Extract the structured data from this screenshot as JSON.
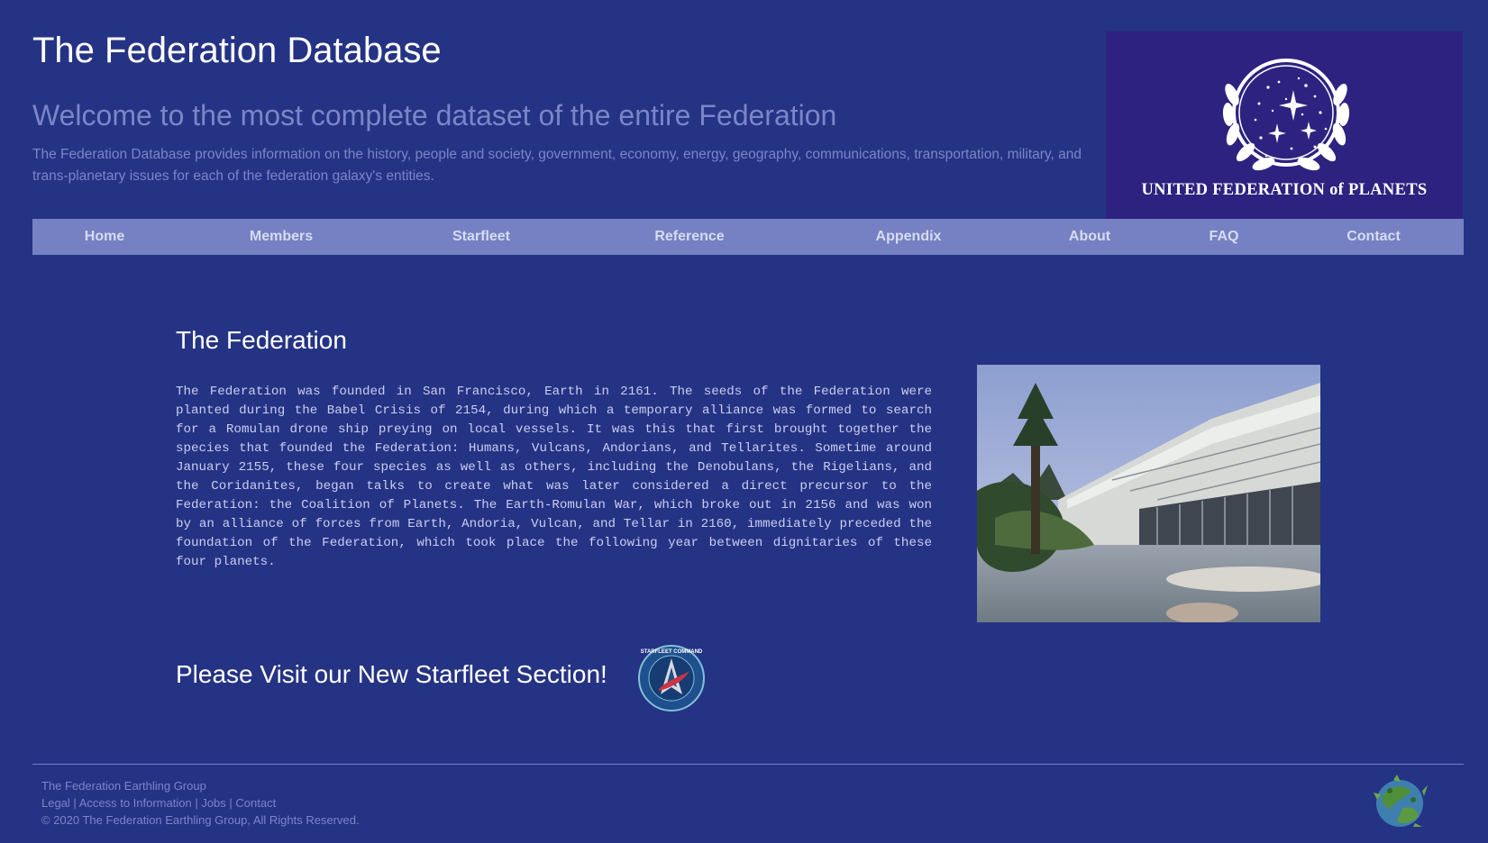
{
  "header": {
    "site_title": "The Federation Database",
    "welcome_heading": "Welcome to the most complete dataset of the entire Federation",
    "intro_text": "The Federation Database provides information on the history, people and society, government, economy, energy, geography, communications, transportation, military, and trans-planetary issues for each of the federation galaxy's entities.",
    "logo_text": "UNITED FEDERATION of PLANETS"
  },
  "nav": {
    "items": [
      {
        "label": "Home"
      },
      {
        "label": "Members"
      },
      {
        "label": "Starfleet"
      },
      {
        "label": "Reference"
      },
      {
        "label": "Appendix"
      },
      {
        "label": "About"
      },
      {
        "label": "FAQ"
      },
      {
        "label": "Contact"
      }
    ]
  },
  "main": {
    "section_title": "The Federation",
    "section_body": "The Federation was founded in San Francisco, Earth in 2161. The seeds of the Federation were planted during the Babel Crisis of 2154, during which a temporary alliance was formed to search for a Romulan drone ship preying on local vessels. It was this that first brought together the species that founded the Federation: Humans, Vulcans, Andorians, and Tellarites. Sometime around January 2155, these four species as well as others, including the Denobulans, the Rigelians, and the Coridanites, began talks to create what was later considered a direct precursor to the Federation: the Coalition of Planets. The Earth-Romulan War, which broke out in 2156 and was won by an alliance of forces from Earth, Andoria, Vulcan, and Tellar in 2160, immediately preceded the foundation of the Federation, which took place the following year between dignitaries of these four planets.",
    "visit_text": "Please Visit our New Starfleet Section!",
    "badge_text": "STARFLEET COMMAND"
  },
  "footer": {
    "group_name": "The Federation Earthling Group",
    "links": [
      {
        "label": "Legal"
      },
      {
        "label": "Access to Information"
      },
      {
        "label": "Jobs"
      },
      {
        "label": "Contact"
      }
    ],
    "separator": " | ",
    "copyright": "© 2020 The Federation Earthling Group, All Rights Reserved."
  },
  "colors": {
    "page_background": "#253384",
    "nav_background": "#7581c2",
    "muted_text": "#7a86c8",
    "logo_background": "#2d2280"
  }
}
